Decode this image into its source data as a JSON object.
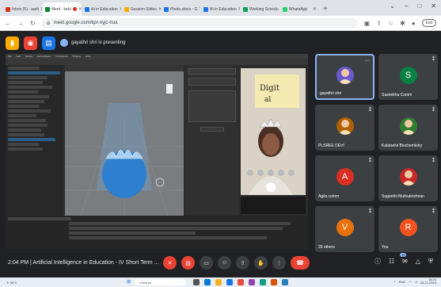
{
  "browser": {
    "tabs": [
      {
        "label": "Inbox (5) - aarti",
        "color": "#d93025"
      },
      {
        "label": "Meet - kebi",
        "color": "#00832d",
        "active": true
      },
      {
        "label": "AI in Education",
        "color": "#1a73e8"
      },
      {
        "label": "Session Slides",
        "color": "#f9ab00"
      },
      {
        "label": "Photo.stocs - G",
        "color": "#1a73e8"
      },
      {
        "label": "AI in Education",
        "color": "#1a73e8"
      },
      {
        "label": "Working Schedu",
        "color": "#0f9d58"
      },
      {
        "label": "WhatsApp",
        "color": "#25d366"
      }
    ],
    "new_tab": "+",
    "url": "meet.google.com/kpr-nyjc-hua",
    "exit_label": "Exit"
  },
  "presentation": {
    "presenting_text": "gayathri shri is presenting"
  },
  "participants": [
    {
      "name": "gayathri shri",
      "initial": "",
      "avatar_color": "#6a5acd",
      "active": true
    },
    {
      "name": "Sasirekha Comm",
      "initial": "S",
      "avatar_color": "#0b8043"
    },
    {
      "name": "PLSREE DEVI",
      "initial": "",
      "avatar_color": "#b06000"
    },
    {
      "name": "Kalaiselvi Biochemistry",
      "initial": "",
      "avatar_color": "#2e7d32"
    },
    {
      "name": "Agila comm",
      "initial": "A",
      "avatar_color": "#d93025"
    },
    {
      "name": "Suganthi Muthukrishnan",
      "initial": "",
      "avatar_color": "#c62828"
    },
    {
      "name": "26 others",
      "initial": "V",
      "avatar_color": "#e8710a"
    },
    {
      "name": "You",
      "initial": "R",
      "avatar_color": "#f4511e"
    }
  ],
  "meeting": {
    "time": "2:04 PM",
    "separator": "|",
    "title": "Artificial Intelligence in Education - IV Short Term ...",
    "participant_count": "35"
  },
  "taskbar": {
    "weather": "30°C",
    "search_placeholder": "Search",
    "lang": "ENG",
    "time": "14:04",
    "date": "26-11-2024"
  }
}
